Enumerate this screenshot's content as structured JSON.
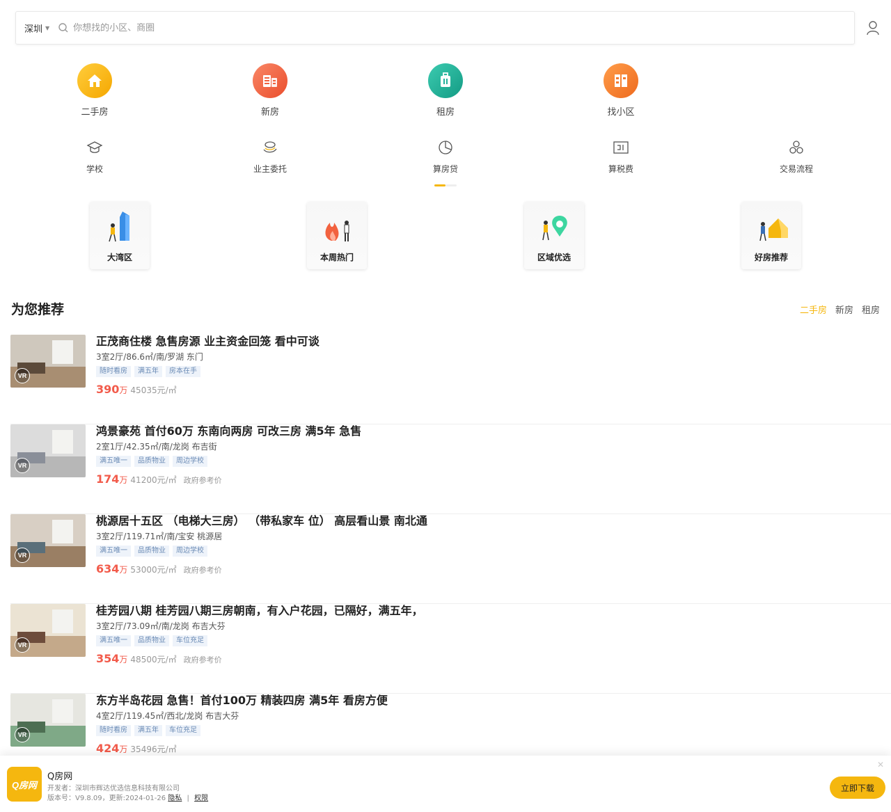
{
  "search": {
    "city": "深圳",
    "placeholder": "你想找的小区、商圈"
  },
  "nav": [
    {
      "label": "二手房",
      "color": "#f8b91a",
      "icon": "home-icon"
    },
    {
      "label": "新房",
      "color": "#f2623f",
      "icon": "building-icon"
    },
    {
      "label": "租房",
      "color": "#22b29b",
      "icon": "luggage-icon"
    },
    {
      "label": "找小区",
      "color": "#f57a2d",
      "icon": "community-icon"
    }
  ],
  "subnav": [
    {
      "label": "学校",
      "icon": "school-icon"
    },
    {
      "label": "业主委托",
      "icon": "entrust-icon"
    },
    {
      "label": "算房贷",
      "icon": "loan-icon"
    },
    {
      "label": "算税费",
      "icon": "tax-icon"
    },
    {
      "label": "交易流程",
      "icon": "process-icon"
    }
  ],
  "cards": [
    {
      "label": "大湾区"
    },
    {
      "label": "本周热门"
    },
    {
      "label": "区域优选"
    },
    {
      "label": "好房推荐"
    }
  ],
  "section": {
    "title": "为您推荐",
    "tabs": [
      "二手房",
      "新房",
      "租房"
    ]
  },
  "listings": [
    {
      "title": "正茂商住楼 急售房源 业主资金回笼 看中可谈",
      "sub": "3室2厅/86.6㎡/南/罗湖 东门",
      "tags": [
        "随时看房",
        "满五年",
        "房本在手"
      ],
      "price": "390",
      "unit": "万",
      "avg": "45035元/㎡",
      "gov": ""
    },
    {
      "title": "鸿景豪苑 首付60万 东南向两房 可改三房 满5年 急售",
      "sub": "2室1厅/42.35㎡/南/龙岗 布吉街",
      "tags": [
        "满五唯一",
        "品质物业",
        "周边学校"
      ],
      "price": "174",
      "unit": "万",
      "avg": "41200元/㎡",
      "gov": "政府参考价"
    },
    {
      "title": "桃源居十五区 （电梯大三房） （带私家车 位） 高层看山景 南北通",
      "sub": "3室2厅/119.71㎡/南/宝安 桃源居",
      "tags": [
        "满五唯一",
        "品质物业",
        "周边学校"
      ],
      "price": "634",
      "unit": "万",
      "avg": "53000元/㎡",
      "gov": "政府参考价"
    },
    {
      "title": "桂芳园八期 桂芳园八期三房朝南，有入户花园，已隔好，满五年，",
      "sub": "3室2厅/73.09㎡/南/龙岗 布吉大芬",
      "tags": [
        "满五唯一",
        "品质物业",
        "车位充足"
      ],
      "price": "354",
      "unit": "万",
      "avg": "48500元/㎡",
      "gov": "政府参考价"
    },
    {
      "title": "东方半岛花园 急售！首付100万 精装四房 满5年 看房方便",
      "sub": "4室2厅/119.45㎡/西北/龙岗 布吉大芬",
      "tags": [
        "随时看房",
        "满五年",
        "车位充足"
      ],
      "price": "424",
      "unit": "万",
      "avg": "35496元/㎡",
      "gov": ""
    }
  ],
  "download": {
    "logo": "Q房网",
    "name": "Q房网",
    "developer": "开发者：深圳市辉达优选信息科技有限公司",
    "version": "版本号：V9.8.09，更新:2024-01-26",
    "privacy": "隐私",
    "divider": "|",
    "permission": "权限",
    "close": "✕",
    "button": "立即下载"
  }
}
